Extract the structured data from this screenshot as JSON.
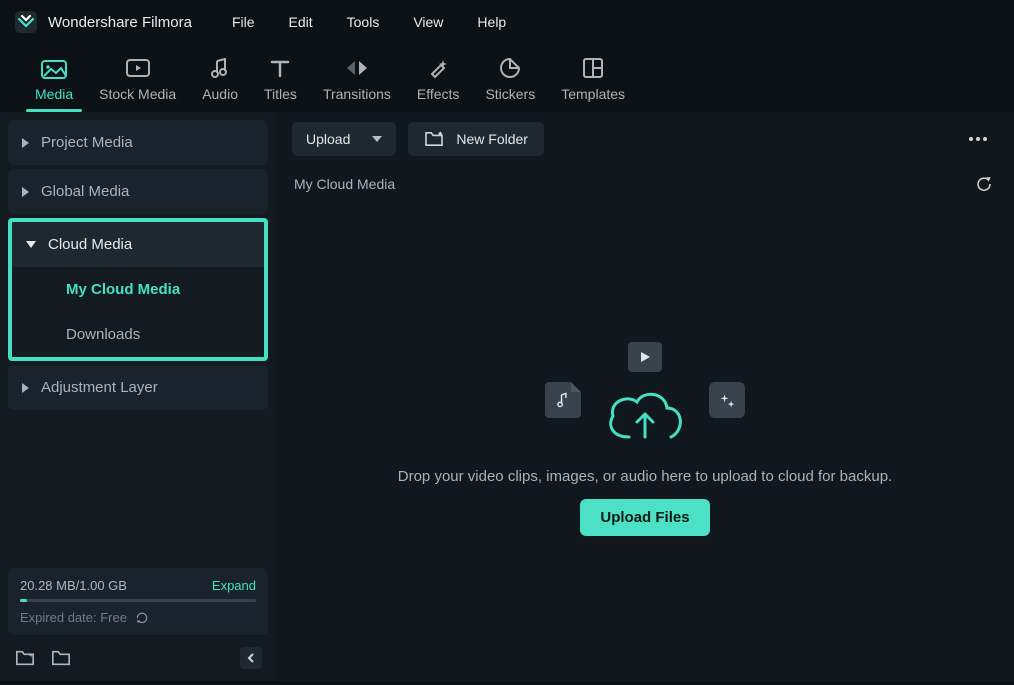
{
  "app": {
    "title": "Wondershare Filmora"
  },
  "menu": [
    "File",
    "Edit",
    "Tools",
    "View",
    "Help"
  ],
  "tabs": [
    {
      "label": "Media",
      "active": true
    },
    {
      "label": "Stock Media"
    },
    {
      "label": "Audio"
    },
    {
      "label": "Titles"
    },
    {
      "label": "Transitions"
    },
    {
      "label": "Effects"
    },
    {
      "label": "Stickers"
    },
    {
      "label": "Templates"
    }
  ],
  "sidebar": {
    "project_media": "Project Media",
    "global_media": "Global Media",
    "cloud_media": "Cloud Media",
    "my_cloud_media": "My Cloud Media",
    "downloads": "Downloads",
    "adjustment_layer": "Adjustment Layer"
  },
  "storage": {
    "usage": "20.28 MB/1.00 GB",
    "expand": "Expand",
    "expired": "Expired date: Free"
  },
  "toolbar": {
    "upload": "Upload",
    "new_folder": "New Folder",
    "breadcrumb": "My Cloud Media"
  },
  "dropzone": {
    "text": "Drop your video clips, images, or audio here to upload to cloud for backup.",
    "button": "Upload Files"
  }
}
